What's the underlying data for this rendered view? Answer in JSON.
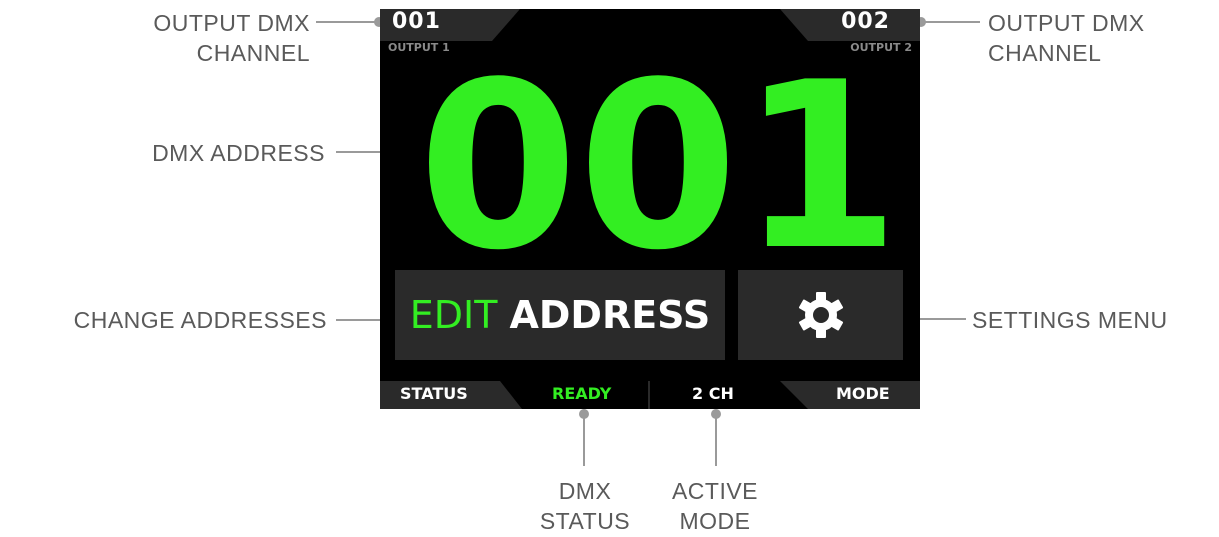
{
  "callouts": {
    "output_dmx_channel_left": [
      "OUTPUT DMX",
      "CHANNEL"
    ],
    "output_dmx_channel_right": [
      "OUTPUT DMX",
      "CHANNEL"
    ],
    "dmx_address": "DMX ADDRESS",
    "change_addresses": "CHANGE ADDRESSES",
    "settings_menu": "SETTINGS MENU",
    "dmx_status": [
      "DMX",
      "STATUS"
    ],
    "active_mode": [
      "ACTIVE",
      "MODE"
    ]
  },
  "screen": {
    "output1": {
      "channel": "001",
      "label": "OUTPUT 1"
    },
    "output2": {
      "channel": "002",
      "label": "OUTPUT 2"
    },
    "address_digits": [
      "0",
      "0",
      "1"
    ],
    "edit_button": {
      "edit": "EDIT",
      "address": "ADDRESS"
    },
    "settings_icon": "gear-icon",
    "status_bar": {
      "status_label": "STATUS",
      "status_value": "READY",
      "mode_value": "2 CH",
      "mode_label": "MODE"
    }
  },
  "colors": {
    "accent_green": "#33ee22",
    "screen_bg": "#000000",
    "panel_bg": "#2a2a2a",
    "callout_text": "#5a5a5a"
  }
}
